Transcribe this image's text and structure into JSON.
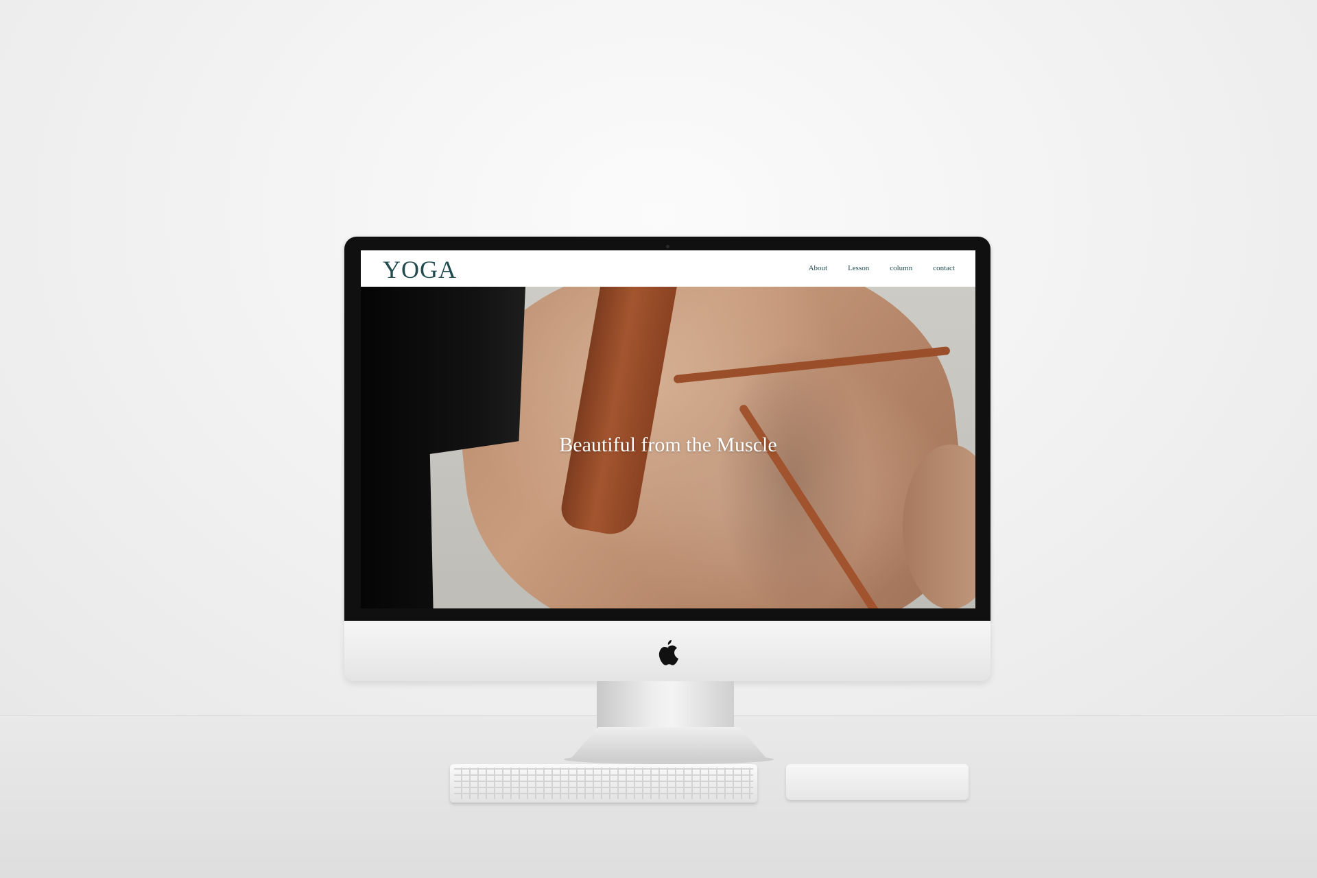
{
  "site": {
    "logo": "YOGA",
    "nav": [
      {
        "label": "About"
      },
      {
        "label": "Lesson"
      },
      {
        "label": "column"
      },
      {
        "label": "contact"
      }
    ]
  },
  "hero": {
    "title": "Beautiful from the Muscle"
  },
  "icons": {
    "device_logo": "apple-icon"
  },
  "colors": {
    "brand": "#1f4a4e",
    "hero_text": "#ffffff",
    "strap": "#9a4e2a"
  }
}
